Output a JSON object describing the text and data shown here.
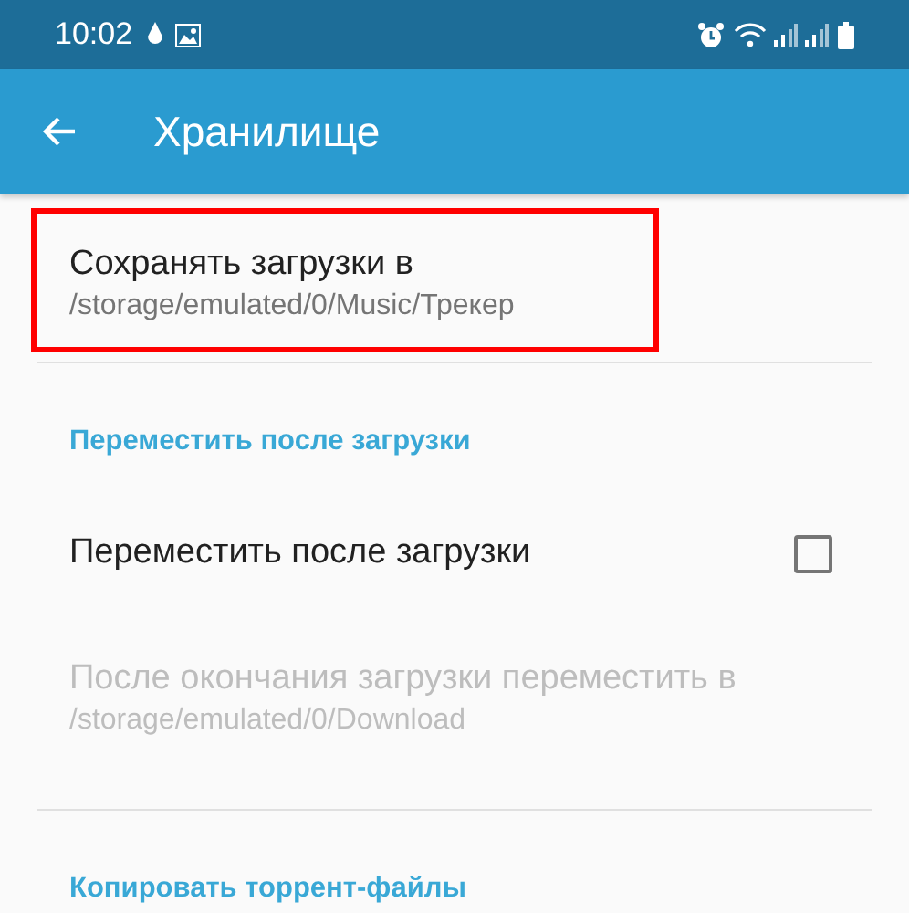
{
  "status_bar": {
    "time": "10:02"
  },
  "app_bar": {
    "title": "Хранилище"
  },
  "items": [
    {
      "kind": "preference",
      "title": "Сохранять загрузки в",
      "summary": "/storage/emulated/0/Music/Трекер",
      "disabled": false,
      "highlighted": true
    },
    {
      "kind": "category",
      "title": "Переместить после загрузки"
    },
    {
      "kind": "checkbox",
      "title": "Переместить после загрузки",
      "checked": false
    },
    {
      "kind": "preference",
      "title": "После окончания загрузки переместить в",
      "summary": "/storage/emulated/0/Download",
      "disabled": true,
      "highlighted": false
    },
    {
      "kind": "category",
      "title": "Копировать торрент-файлы"
    }
  ]
}
